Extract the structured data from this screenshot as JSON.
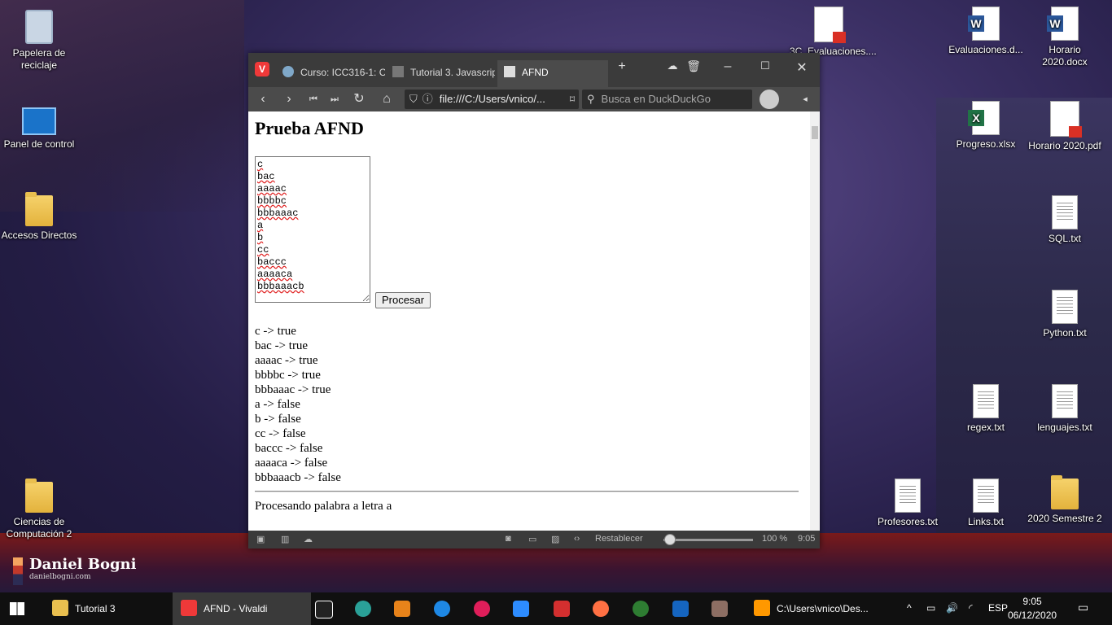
{
  "desktop": {
    "icons_left": [
      {
        "label": "Papelera de reciclaje",
        "icon": "recycle-bin-icon"
      },
      {
        "label": "Panel de control",
        "icon": "control-panel-icon"
      },
      {
        "label": "Accesos Directos",
        "icon": "folder-icon"
      },
      {
        "label": "Ciencias de Computación 2",
        "icon": "folder-icon"
      }
    ],
    "icons_right": [
      {
        "label": "3C_Evaluaciones....",
        "icon": "pdf-icon"
      },
      {
        "label": "Evaluaciones.d...",
        "icon": "word-icon"
      },
      {
        "label": "Horario 2020.docx",
        "icon": "word-icon"
      },
      {
        "label": "Progreso.xlsx",
        "icon": "excel-icon"
      },
      {
        "label": "Horario 2020.pdf",
        "icon": "pdf-icon"
      },
      {
        "label": "SQL.txt",
        "icon": "text-file-icon"
      },
      {
        "label": "Python.txt",
        "icon": "text-file-icon"
      },
      {
        "label": "regex.txt",
        "icon": "text-file-icon"
      },
      {
        "label": "lenguajes.txt",
        "icon": "text-file-icon"
      },
      {
        "label": "Profesores.txt",
        "icon": "text-file-icon"
      },
      {
        "label": "Links.txt",
        "icon": "text-file-icon"
      },
      {
        "label": "2020 Semestre 2",
        "icon": "folder-icon"
      }
    ],
    "brand": {
      "name": "Daniel Bogni",
      "url": "danielbogni.com"
    }
  },
  "browser": {
    "tabs": [
      {
        "label": "Curso: ICC316-1: C"
      },
      {
        "label": "Tutorial 3. Javascrip"
      },
      {
        "label": "AFND"
      }
    ],
    "url": "file:///C:/Users/vnico/...",
    "search_placeholder": "Busca en DuckDuckGo",
    "status": {
      "reset_label": "Restablecer",
      "zoom": "100 %",
      "time": "9:05"
    }
  },
  "page": {
    "title": "Prueba AFND",
    "textarea_value": "c\nbac\naaaac\nbbbbc\nbbbaaac\na\nb\ncc\nbaccc\naaaaca\nbbbaaacb",
    "button_label": "Procesar",
    "results": [
      "c -> true",
      "bac -> true",
      "aaaac -> true",
      "bbbbc -> true",
      "bbbaaac -> true",
      "a -> false",
      "b -> false",
      "cc -> false",
      "baccc -> false",
      "aaaaca -> false",
      "bbbaaacb -> false"
    ],
    "status_line": "Procesando palabra a letra a"
  },
  "taskbar": {
    "items": [
      {
        "label": "Tutorial 3"
      },
      {
        "label": "AFND - Vivaldi"
      },
      {
        "label": "C:\\Users\\vnico\\Des..."
      }
    ],
    "language": "ESP",
    "time": "9:05",
    "date": "06/12/2020"
  },
  "colors": {
    "vivaldi_red": "#ef3939",
    "browser_chrome": "#3b3b3b",
    "taskbar": "#101010"
  }
}
